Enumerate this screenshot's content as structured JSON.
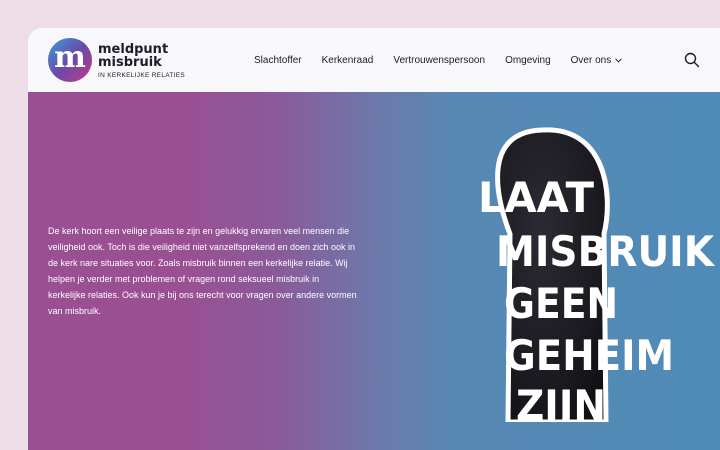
{
  "brand": {
    "mark": "m",
    "name_line1": "meldpunt",
    "name_line2": "misbruik",
    "tagline": "IN KERKELIJKE RELATIES"
  },
  "nav": {
    "items": [
      "Slachtoffer",
      "Kerkenraad",
      "Vertrouwenspersoon",
      "Omgeving",
      "Over ons"
    ]
  },
  "hero": {
    "text": "De kerk hoort een veilige plaats te zijn en gelukkig ervaren veel mensen die veiligheid ook. Toch is die veiligheid niet vanzelfsprekend en doen zich ook in de kerk nare situaties voor. Zoals misbruik binnen een kerkelijke relatie. Wij helpen je verder met problemen of vragen rond seksueel misbruik in kerkelijke relaties. Ook kun je bij ons terecht voor vragen over andere vormen van misbruik.",
    "slogan": [
      "LAAT",
      "MISBRUIK",
      "GEEN",
      "GEHEIM",
      "ZIJN"
    ]
  },
  "colors": {
    "page_bg": "#ecdde6",
    "topbar_bg": "#f8f8fa",
    "hero_purple": "#9a4f92",
    "hero_blue": "#4f8bb8"
  }
}
